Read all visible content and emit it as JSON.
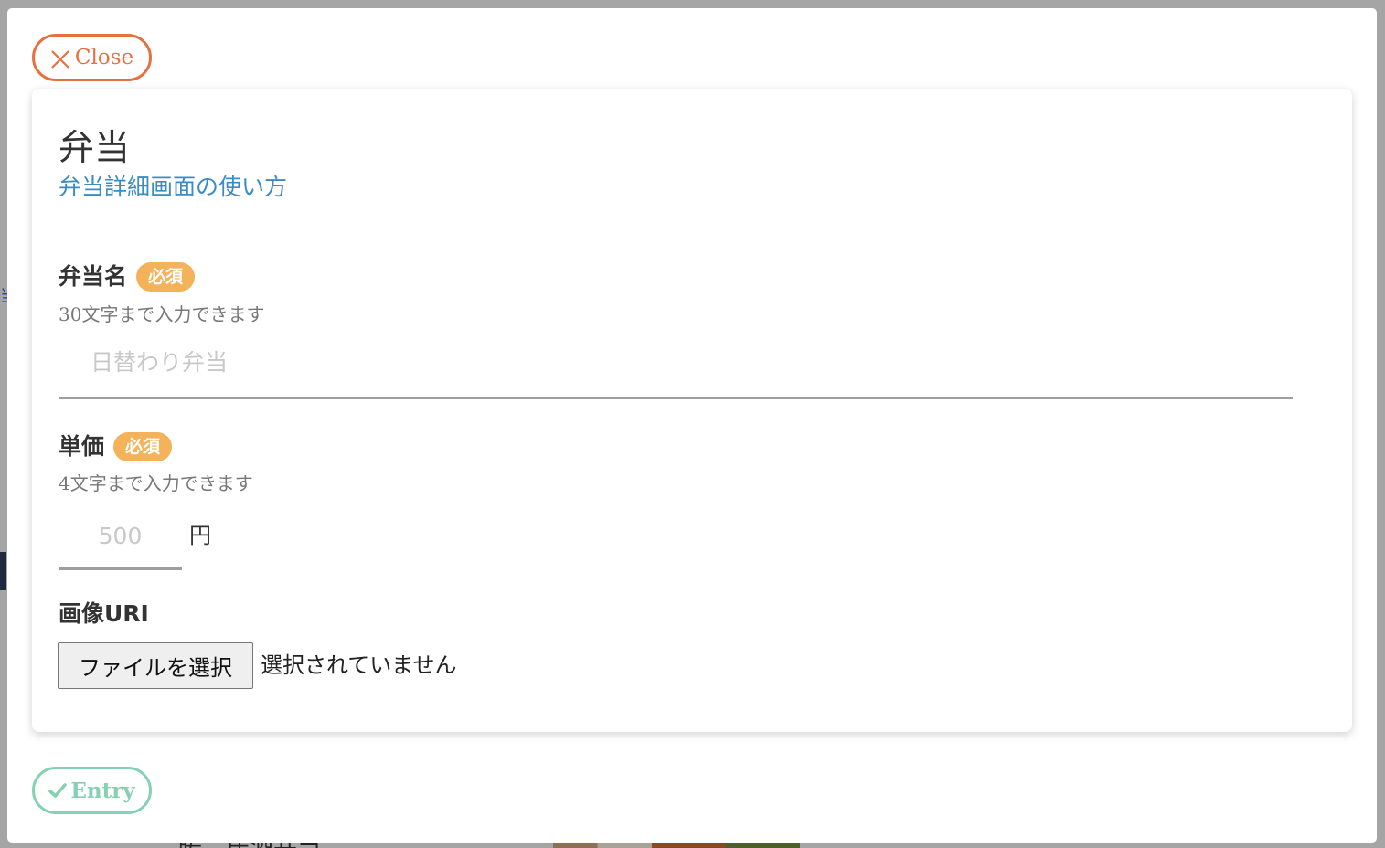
{
  "modal": {
    "close_label": "Close",
    "entry_label": "Entry",
    "title": "弁当",
    "help_link": "弁当詳細画面の使い方"
  },
  "fields": {
    "name": {
      "label": "弁当名",
      "badge": "必須",
      "help": "30文字まで入力できます",
      "placeholder": "日替わり弁当",
      "value": ""
    },
    "price": {
      "label": "単価",
      "badge": "必須",
      "help": "4文字まで入力できます",
      "placeholder": "500",
      "value": "",
      "unit": "円"
    },
    "image": {
      "label": "画像URI",
      "button_label": "ファイルを選択",
      "status": "選択されていません"
    }
  },
  "background": {
    "bottom_text": "暖　居酒弁当"
  },
  "colors": {
    "close_accent": "#e8703e",
    "entry_accent": "#86d1b4",
    "badge": "#f4b25b",
    "link": "#3c8cc4"
  },
  "icons": {
    "close": "close-icon",
    "entry": "check-icon"
  }
}
